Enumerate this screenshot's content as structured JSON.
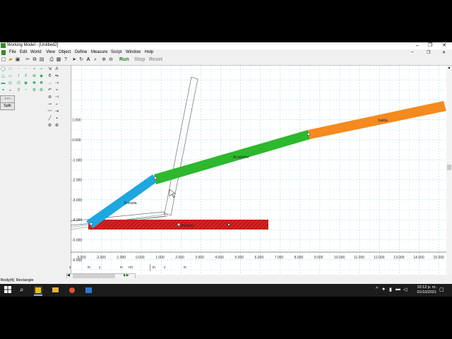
{
  "window": {
    "title": "Working Model - [Untitled2]",
    "controls": [
      "–",
      "❐",
      "✕"
    ]
  },
  "menu": [
    "File",
    "Edit",
    "World",
    "View",
    "Object",
    "Define",
    "Measure",
    "Script",
    "Window",
    "Help"
  ],
  "toolbar": {
    "run_label": "Run",
    "stop_label": "Stop",
    "reset_label": "Reset"
  },
  "palette": {
    "join_label": "Join",
    "split_label": "Split"
  },
  "canvas": {
    "y_ticks": [
      "1.000",
      "0.000",
      "-1.000",
      "-2.000",
      "-3.000",
      "-4.000",
      "-5.000",
      "-6.000",
      "-7.000"
    ],
    "x_ticks": [
      "-3.000",
      "-2.000",
      "-1.000",
      "0.000",
      "1.000",
      "2.000",
      "3.000",
      "4.000",
      "5.000",
      "6.000",
      "7.000",
      "8.000",
      "9.000",
      "10.000",
      "11.000",
      "12.000",
      "13.000",
      "14.000",
      "15.000"
    ],
    "body_labels": {
      "entrada": "Entrada",
      "acoplador": "Acoplador",
      "salida": "Salida",
      "bastidor": "Bastidor"
    },
    "colors": {
      "entrada": "#1ea7e0",
      "acoplador": "#2db82d",
      "salida": "#f58a1e",
      "bastidor": "#d92020",
      "grid": "#8fd4e8"
    }
  },
  "coord_bar": [
    "x",
    "in",
    "y",
    "in",
    "rot",
    "in",
    "x",
    "in",
    "y",
    "in"
  ],
  "status": "Body[4]: Rectangle",
  "taskbar": {
    "time": "10:12 p. m.",
    "date": "01/10/2021"
  }
}
